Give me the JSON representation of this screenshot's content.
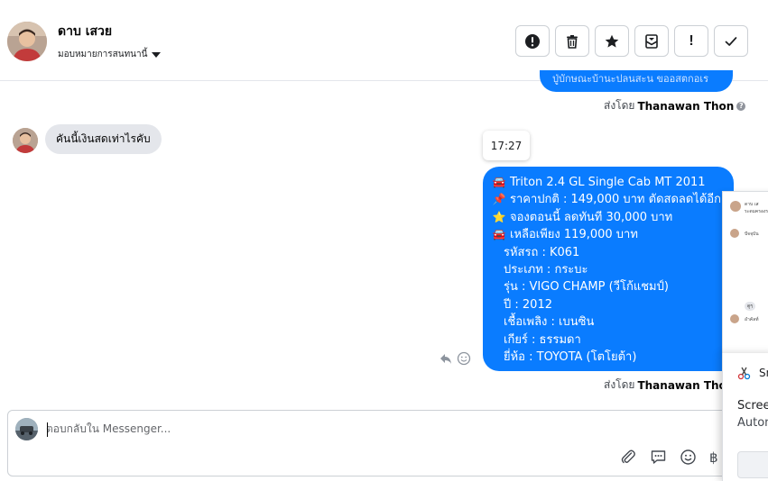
{
  "header": {
    "contact_name": "ดาบ เสวย",
    "assign_label": "มอบหมายการสนทนานี้",
    "toolbar": {
      "spam_icon": "alert-circle-icon",
      "delete_icon": "trash-icon",
      "star_icon": "star-icon",
      "archive_icon": "archive-icon",
      "follow_up_label": "!",
      "done_icon": "check-icon"
    }
  },
  "conversation": {
    "top_bubble_text": "ปู่บักษณะบ้านะปลนสะน ขออสตกอเร",
    "sent_by_prefix": "ส่งโดย",
    "sent_by_name": "Thanawan Thon",
    "incoming_message": "คันนี้เงินสดเท่าไรคับ",
    "timestamp": "17:27",
    "outgoing_lines": [
      {
        "emoji": "🚘",
        "text": "Triton 2.4 GL Single Cab MT 2011"
      },
      {
        "emoji": "📌",
        "text": "ราคาปกติ : 149,000 บาท ตัดสดลดได้อีก"
      },
      {
        "emoji": "⭐",
        "text": "จองตอนนี้ ลดทันที 30,000 บาท"
      },
      {
        "emoji": "🚘",
        "text": "เหลือเพียง 119,000 บาท"
      },
      {
        "emoji": "",
        "text": "รหัสรถ : K061"
      },
      {
        "emoji": "",
        "text": "ประเภท : กระบะ"
      },
      {
        "emoji": "",
        "text": "รุ่น : VIGO CHAMP (วีโก้แชมป์)"
      },
      {
        "emoji": "",
        "text": "ปี : 2012"
      },
      {
        "emoji": "",
        "text": "เชื้อเพลิง : เบนซิน"
      },
      {
        "emoji": "",
        "text": "เกียร์ : ธรรมดา"
      },
      {
        "emoji": "",
        "text": "ยี่ห้อ : TOYOTA (โตโยต้า)"
      }
    ],
    "sent_by_prefix_2": "ส่งโดย",
    "sent_by_name_2": "Thanawan Thon"
  },
  "composer": {
    "placeholder": "ตอบกลับใน Messenger...",
    "attach_icon": "paperclip-icon",
    "saved_reply_icon": "chat-bubble-icon",
    "emoji_icon": "smiley-icon",
    "currency_label": "฿"
  },
  "side_preview": {
    "name": "ดาบ เส",
    "line1": "ระดมครองร",
    "line2": "ปัจจุบัน",
    "bubble": "ดูๆ",
    "line3": "อำคัลท์"
  },
  "notification": {
    "app": "Sn",
    "title": "Screen",
    "subtitle": "Autom"
  },
  "colors": {
    "messenger_blue": "#0a7cff",
    "incoming_gray": "#e4e6eb",
    "border": "#ccd0d5"
  }
}
